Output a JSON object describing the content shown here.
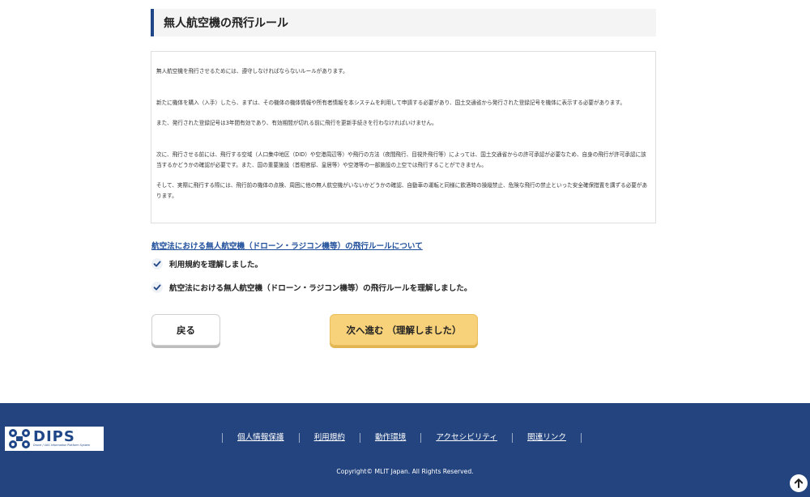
{
  "page": {
    "section_title": "無人航空機の飛行ルール"
  },
  "notice": {
    "paragraphs": [
      "無人航空機を飛行させるためには、遵守しなければならないルールがあります。",
      "新たに機体を購入（入手）したら、まずは、その機体の機体情報や所有者情報を本システムを利用して申請する必要があり、国土交通省から発行された登録記号を機体に表示する必要があります。",
      "また、発行された登録記号は3年間有効であり、有効期間が切れる前に飛行を更新手続きを行わなければいけません。",
      "次に、飛行させる前には、飛行する空域（人口集中地区（DID）や空港周辺等）や飛行の方法（夜間飛行、目視外飛行等）によっては、国土交通省からの許可承認が必要なため、自身の飛行が許可承認に該当するかどうかの確認が必要です。また、国の重要施設（首相官邸、皇居等）や空港等の一部施設の上空では飛行することができません。",
      "そして、実際に飛行する際には、飛行前の機体の点検、周囲に他の無人航空機がいないかどうかの確認、自動車の運転と同様に飲酒時の操縦禁止、危険な飛行の禁止といった安全確保措置を講ずる必要があります。"
    ]
  },
  "rule_link": "航空法における無人航空機（ドローン・ラジコン機等）の飛行ルールについて",
  "checks": [
    {
      "label": "利用規約を理解しました。",
      "checked": true
    },
    {
      "label": "航空法における無人航空機（ドローン・ラジコン機等）の飛行ルールを理解しました。",
      "checked": true
    }
  ],
  "buttons": {
    "back": "戻る",
    "next": "次へ進む （理解しました）"
  },
  "footer": {
    "logo_main": "DIPS",
    "logo_sub": "Drone / UAS Information Platform System",
    "links": [
      "個人情報保護",
      "利用規約",
      "動作環境",
      "アクセシビリティ",
      "関連リンク"
    ],
    "copyright": "Copyright© MLIT Japan. All Rights Reserved."
  },
  "colors": {
    "brand_blue": "#23447f",
    "accent_yellow": "#f7d27a",
    "link_blue": "#1f4e9a"
  }
}
